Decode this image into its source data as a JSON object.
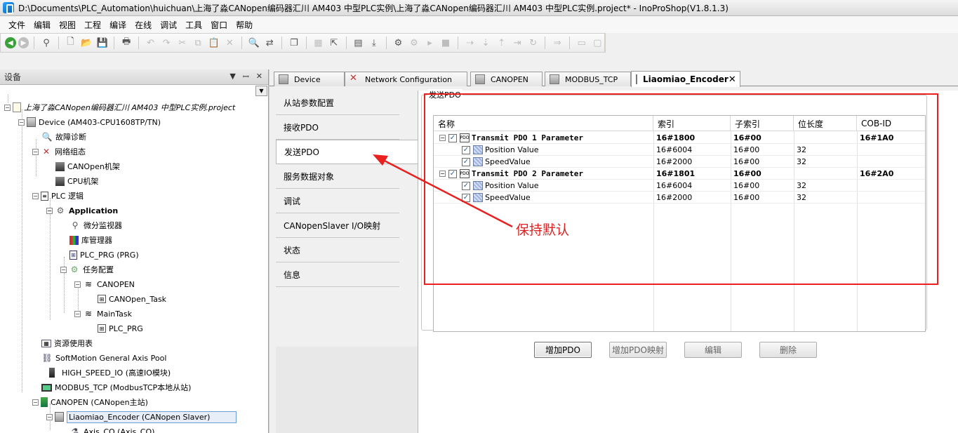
{
  "window": {
    "title": "D:\\Documents\\PLC_Automation\\huichuan\\上海了淼CANopen编码器汇川 AM403 中型PLC实例\\上海了淼CANopen编码器汇川 AM403 中型PLC实例.project* - InoProShop(V1.8.1.3)"
  },
  "menu": [
    "文件",
    "编辑",
    "视图",
    "工程",
    "编译",
    "在线",
    "调试",
    "工具",
    "窗口",
    "帮助"
  ],
  "devices_panel": {
    "title": "设备",
    "pin": "▼",
    "pushpin": "ꟷ",
    "close": "✕"
  },
  "tree": {
    "project": "上海了淼CANopen编码器汇川 AM403 中型PLC实例.project",
    "device": "Device (AM403-CPU1608TP/TN)",
    "diag": "故障诊断",
    "netconfig": "网络组态",
    "canopen_rack": "CANOpen机架",
    "cpu_rack": "CPU机架",
    "plc_logic": "PLC 逻辑",
    "application": "Application",
    "diff_monitor": "微分监视器",
    "lib_manager": "库管理器",
    "plc_prg": "PLC_PRG (PRG)",
    "task_config": "任务配置",
    "canopen_task_grp": "CANOPEN",
    "canopen_task": "CANOpen_Task",
    "main_task": "MainTask",
    "plc_prg_call": "PLC_PRG",
    "resources": "资源使用表",
    "softmotion": "SoftMotion General Axis Pool",
    "high_speed": "HIGH_SPEED_IO (高速IO模块)",
    "modbus": "MODBUS_TCP (ModbusTCP本地从站)",
    "canopen_master": "CANOPEN (CANopen主站)",
    "encoder": "Liaomiao_Encoder (CANopen Slaver)",
    "axis": "Axis_CO (Axis_CO)"
  },
  "tabs": [
    {
      "label": "Device"
    },
    {
      "label": "Network Configuration"
    },
    {
      "label": "CANOPEN"
    },
    {
      "label": "MODBUS_TCP"
    },
    {
      "label": "Liaomiao_Encoder",
      "close": "✕"
    }
  ],
  "side_tabs": [
    "从站参数配置",
    "接收PDO",
    "发送PDO",
    "服务数据对象",
    "调试",
    "CANopenSlaver I/O映射",
    "状态",
    "信息"
  ],
  "pdo": {
    "group_label": "发送PDO",
    "columns": [
      "名称",
      "索引",
      "子索引",
      "位长度",
      "COB-ID"
    ],
    "pdo_icon": "PDO",
    "check": "✓",
    "expand": "−",
    "rows": [
      {
        "name": "Transmit PDO 1 Parameter",
        "index": "16#1800",
        "sub": "16#00",
        "len": "",
        "cob": "16#1A0"
      },
      {
        "name": "Position Value",
        "index": "16#6004",
        "sub": "16#00",
        "len": "32",
        "cob": ""
      },
      {
        "name": "SpeedValue",
        "index": "16#2000",
        "sub": "16#00",
        "len": "32",
        "cob": ""
      },
      {
        "name": "Transmit PDO 2 Parameter",
        "index": "16#1801",
        "sub": "16#00",
        "len": "",
        "cob": "16#2A0"
      },
      {
        "name": "Position Value",
        "index": "16#6004",
        "sub": "16#00",
        "len": "32",
        "cob": ""
      },
      {
        "name": "SpeedValue",
        "index": "16#2000",
        "sub": "16#00",
        "len": "32",
        "cob": ""
      }
    ]
  },
  "buttons": {
    "add_pdo": "增加PDO",
    "add_mapping": "增加PDO映射",
    "edit": "编辑",
    "delete": "删除"
  },
  "annotation": {
    "text": "保持默认",
    "color": "#e02020"
  }
}
